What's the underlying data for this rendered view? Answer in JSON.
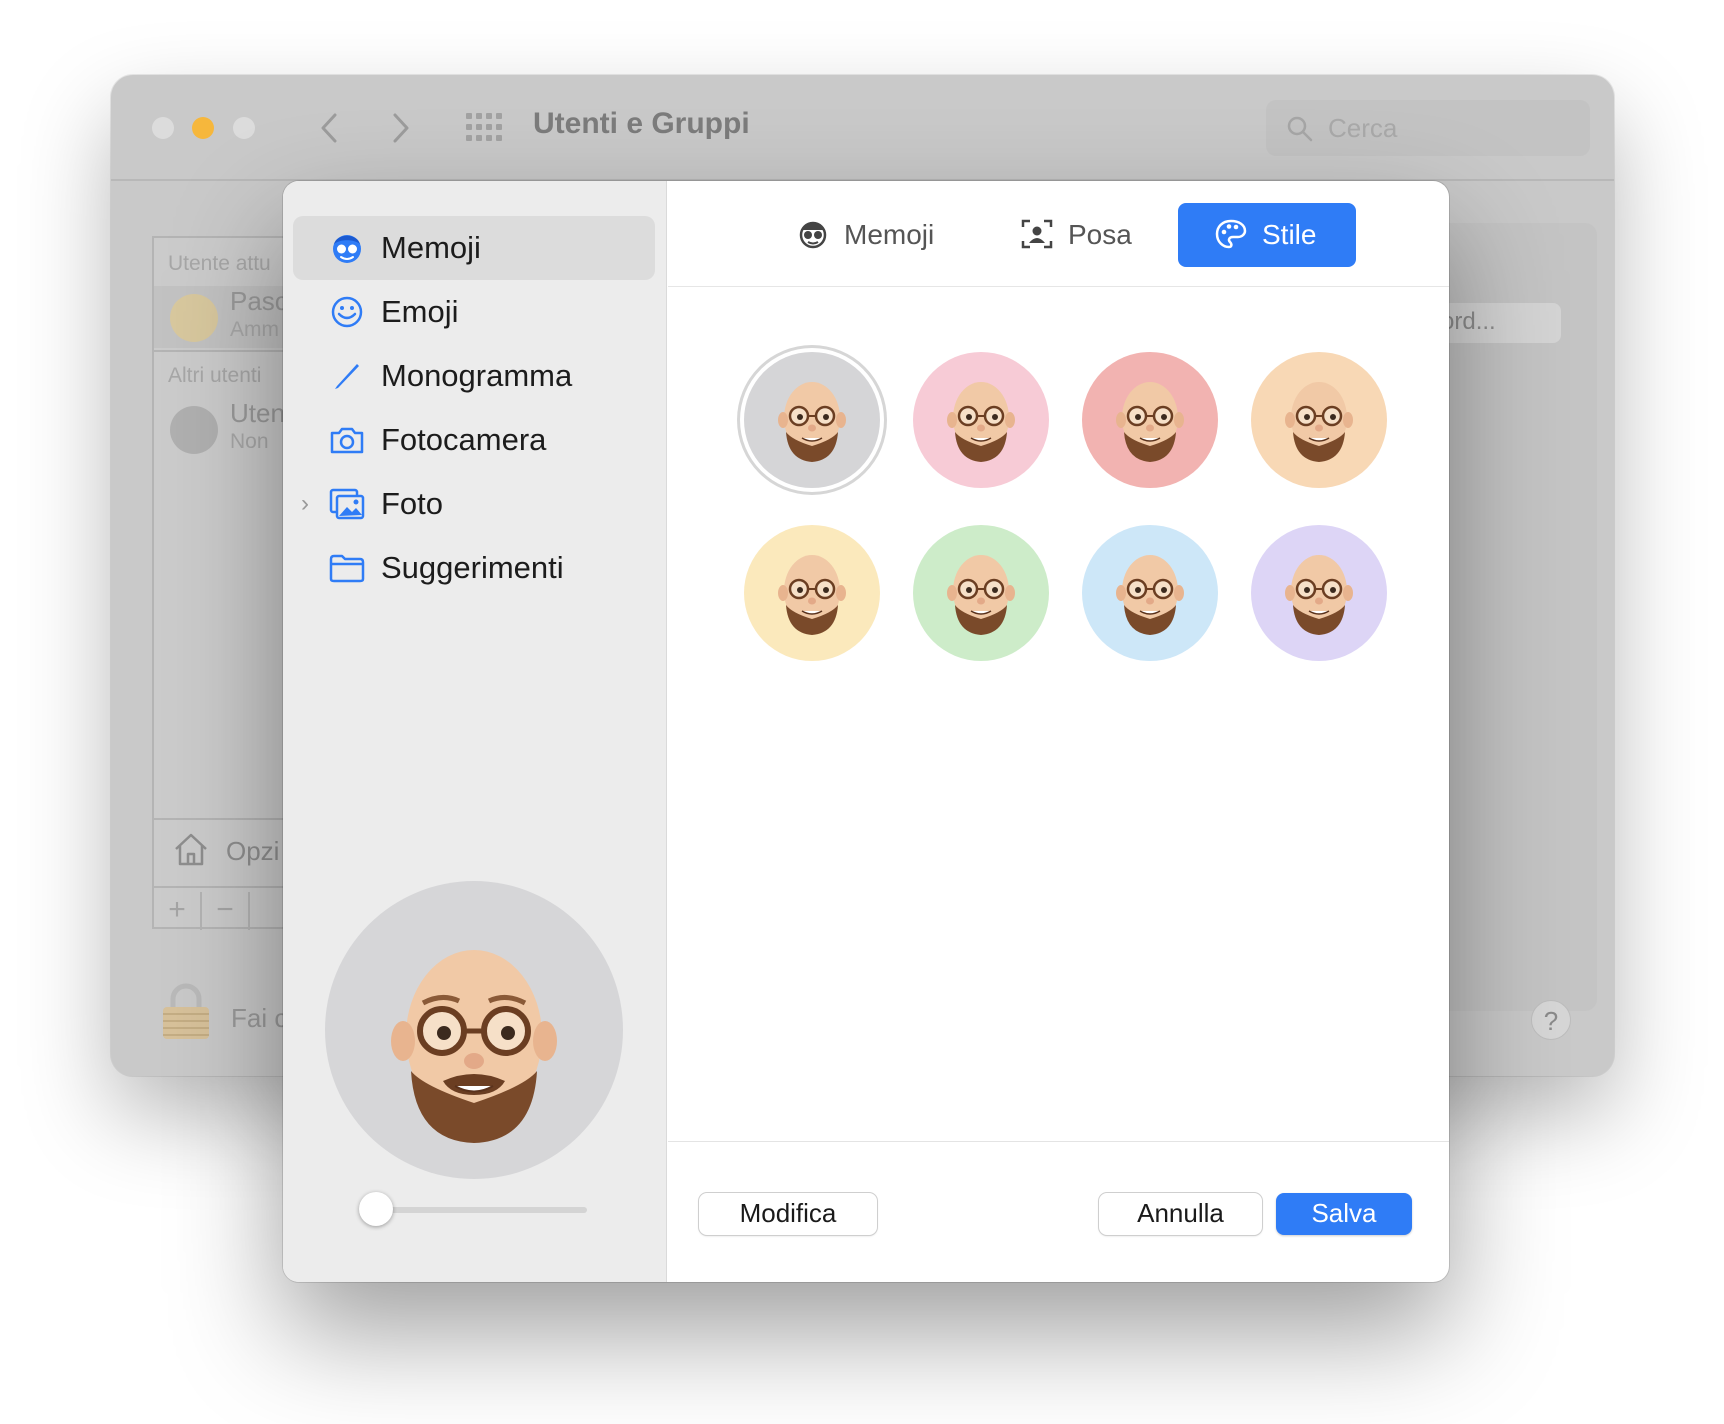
{
  "background_window": {
    "title": "Utenti e Gruppi",
    "search_placeholder": "Cerca",
    "list": {
      "section_current": "Utente attu",
      "current_user_name": "Pasc",
      "current_user_role": "Amm",
      "section_others": "Altri utenti",
      "other_user_name": "Uten",
      "other_user_sub": "Non",
      "options_label": "Opzi",
      "add_label": "+",
      "remove_label": "−"
    },
    "password_button": "ord...",
    "lock_text": "Fai c",
    "help_label": "?"
  },
  "dialog": {
    "sidebar": {
      "items": [
        {
          "label": "Memoji",
          "icon": "memoji-icon",
          "selected": true
        },
        {
          "label": "Emoji",
          "icon": "smiley-icon",
          "selected": false
        },
        {
          "label": "Monogramma",
          "icon": "pencil-icon",
          "selected": false
        },
        {
          "label": "Fotocamera",
          "icon": "camera-icon",
          "selected": false
        },
        {
          "label": "Foto",
          "icon": "photos-icon",
          "selected": false,
          "expandable": true
        },
        {
          "label": "Suggerimenti",
          "icon": "folder-icon",
          "selected": false
        }
      ],
      "zoom_slider_value": 0
    },
    "tabs": [
      {
        "label": "Memoji",
        "icon": "memoji-face-icon",
        "active": false
      },
      {
        "label": "Posa",
        "icon": "pose-icon",
        "active": false
      },
      {
        "label": "Stile",
        "icon": "palette-icon",
        "active": true
      }
    ],
    "styles": [
      {
        "name": "grey",
        "color": "#d5d5d7",
        "selected": true
      },
      {
        "name": "pink",
        "color": "#f7cbd6",
        "selected": false
      },
      {
        "name": "red",
        "color": "#f2b3b1",
        "selected": false
      },
      {
        "name": "peach",
        "color": "#f8d8b5",
        "selected": false
      },
      {
        "name": "yellow",
        "color": "#fbe9bc",
        "selected": false
      },
      {
        "name": "green",
        "color": "#cdecc9",
        "selected": false
      },
      {
        "name": "blue",
        "color": "#cde7f8",
        "selected": false
      },
      {
        "name": "purple",
        "color": "#ddd5f6",
        "selected": false
      }
    ],
    "buttons": {
      "edit": "Modifica",
      "cancel": "Annulla",
      "save": "Salva"
    },
    "accent_color": "#2f7cf6"
  }
}
